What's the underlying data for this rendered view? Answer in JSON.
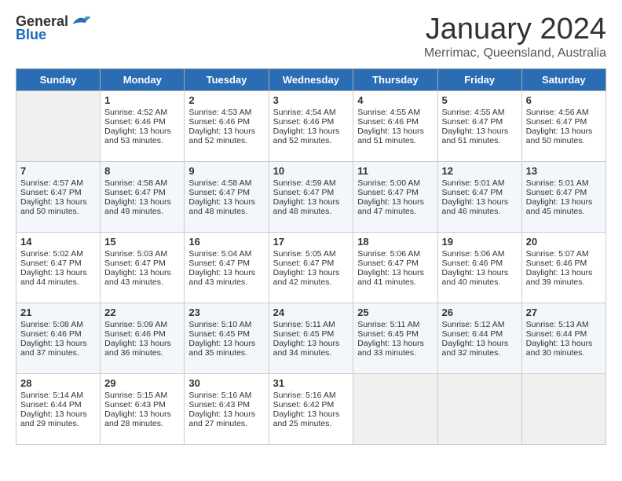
{
  "header": {
    "logo_general": "General",
    "logo_blue": "Blue",
    "title": "January 2024",
    "location": "Merrimac, Queensland, Australia"
  },
  "days_of_week": [
    "Sunday",
    "Monday",
    "Tuesday",
    "Wednesday",
    "Thursday",
    "Friday",
    "Saturday"
  ],
  "weeks": [
    [
      {
        "day": "",
        "sunrise": "",
        "sunset": "",
        "daylight": ""
      },
      {
        "day": "1",
        "sunrise": "Sunrise: 4:52 AM",
        "sunset": "Sunset: 6:46 PM",
        "daylight": "Daylight: 13 hours and 53 minutes."
      },
      {
        "day": "2",
        "sunrise": "Sunrise: 4:53 AM",
        "sunset": "Sunset: 6:46 PM",
        "daylight": "Daylight: 13 hours and 52 minutes."
      },
      {
        "day": "3",
        "sunrise": "Sunrise: 4:54 AM",
        "sunset": "Sunset: 6:46 PM",
        "daylight": "Daylight: 13 hours and 52 minutes."
      },
      {
        "day": "4",
        "sunrise": "Sunrise: 4:55 AM",
        "sunset": "Sunset: 6:46 PM",
        "daylight": "Daylight: 13 hours and 51 minutes."
      },
      {
        "day": "5",
        "sunrise": "Sunrise: 4:55 AM",
        "sunset": "Sunset: 6:47 PM",
        "daylight": "Daylight: 13 hours and 51 minutes."
      },
      {
        "day": "6",
        "sunrise": "Sunrise: 4:56 AM",
        "sunset": "Sunset: 6:47 PM",
        "daylight": "Daylight: 13 hours and 50 minutes."
      }
    ],
    [
      {
        "day": "7",
        "sunrise": "Sunrise: 4:57 AM",
        "sunset": "Sunset: 6:47 PM",
        "daylight": "Daylight: 13 hours and 50 minutes."
      },
      {
        "day": "8",
        "sunrise": "Sunrise: 4:58 AM",
        "sunset": "Sunset: 6:47 PM",
        "daylight": "Daylight: 13 hours and 49 minutes."
      },
      {
        "day": "9",
        "sunrise": "Sunrise: 4:58 AM",
        "sunset": "Sunset: 6:47 PM",
        "daylight": "Daylight: 13 hours and 48 minutes."
      },
      {
        "day": "10",
        "sunrise": "Sunrise: 4:59 AM",
        "sunset": "Sunset: 6:47 PM",
        "daylight": "Daylight: 13 hours and 48 minutes."
      },
      {
        "day": "11",
        "sunrise": "Sunrise: 5:00 AM",
        "sunset": "Sunset: 6:47 PM",
        "daylight": "Daylight: 13 hours and 47 minutes."
      },
      {
        "day": "12",
        "sunrise": "Sunrise: 5:01 AM",
        "sunset": "Sunset: 6:47 PM",
        "daylight": "Daylight: 13 hours and 46 minutes."
      },
      {
        "day": "13",
        "sunrise": "Sunrise: 5:01 AM",
        "sunset": "Sunset: 6:47 PM",
        "daylight": "Daylight: 13 hours and 45 minutes."
      }
    ],
    [
      {
        "day": "14",
        "sunrise": "Sunrise: 5:02 AM",
        "sunset": "Sunset: 6:47 PM",
        "daylight": "Daylight: 13 hours and 44 minutes."
      },
      {
        "day": "15",
        "sunrise": "Sunrise: 5:03 AM",
        "sunset": "Sunset: 6:47 PM",
        "daylight": "Daylight: 13 hours and 43 minutes."
      },
      {
        "day": "16",
        "sunrise": "Sunrise: 5:04 AM",
        "sunset": "Sunset: 6:47 PM",
        "daylight": "Daylight: 13 hours and 43 minutes."
      },
      {
        "day": "17",
        "sunrise": "Sunrise: 5:05 AM",
        "sunset": "Sunset: 6:47 PM",
        "daylight": "Daylight: 13 hours and 42 minutes."
      },
      {
        "day": "18",
        "sunrise": "Sunrise: 5:06 AM",
        "sunset": "Sunset: 6:47 PM",
        "daylight": "Daylight: 13 hours and 41 minutes."
      },
      {
        "day": "19",
        "sunrise": "Sunrise: 5:06 AM",
        "sunset": "Sunset: 6:46 PM",
        "daylight": "Daylight: 13 hours and 40 minutes."
      },
      {
        "day": "20",
        "sunrise": "Sunrise: 5:07 AM",
        "sunset": "Sunset: 6:46 PM",
        "daylight": "Daylight: 13 hours and 39 minutes."
      }
    ],
    [
      {
        "day": "21",
        "sunrise": "Sunrise: 5:08 AM",
        "sunset": "Sunset: 6:46 PM",
        "daylight": "Daylight: 13 hours and 37 minutes."
      },
      {
        "day": "22",
        "sunrise": "Sunrise: 5:09 AM",
        "sunset": "Sunset: 6:46 PM",
        "daylight": "Daylight: 13 hours and 36 minutes."
      },
      {
        "day": "23",
        "sunrise": "Sunrise: 5:10 AM",
        "sunset": "Sunset: 6:45 PM",
        "daylight": "Daylight: 13 hours and 35 minutes."
      },
      {
        "day": "24",
        "sunrise": "Sunrise: 5:11 AM",
        "sunset": "Sunset: 6:45 PM",
        "daylight": "Daylight: 13 hours and 34 minutes."
      },
      {
        "day": "25",
        "sunrise": "Sunrise: 5:11 AM",
        "sunset": "Sunset: 6:45 PM",
        "daylight": "Daylight: 13 hours and 33 minutes."
      },
      {
        "day": "26",
        "sunrise": "Sunrise: 5:12 AM",
        "sunset": "Sunset: 6:44 PM",
        "daylight": "Daylight: 13 hours and 32 minutes."
      },
      {
        "day": "27",
        "sunrise": "Sunrise: 5:13 AM",
        "sunset": "Sunset: 6:44 PM",
        "daylight": "Daylight: 13 hours and 30 minutes."
      }
    ],
    [
      {
        "day": "28",
        "sunrise": "Sunrise: 5:14 AM",
        "sunset": "Sunset: 6:44 PM",
        "daylight": "Daylight: 13 hours and 29 minutes."
      },
      {
        "day": "29",
        "sunrise": "Sunrise: 5:15 AM",
        "sunset": "Sunset: 6:43 PM",
        "daylight": "Daylight: 13 hours and 28 minutes."
      },
      {
        "day": "30",
        "sunrise": "Sunrise: 5:16 AM",
        "sunset": "Sunset: 6:43 PM",
        "daylight": "Daylight: 13 hours and 27 minutes."
      },
      {
        "day": "31",
        "sunrise": "Sunrise: 5:16 AM",
        "sunset": "Sunset: 6:42 PM",
        "daylight": "Daylight: 13 hours and 25 minutes."
      },
      {
        "day": "",
        "sunrise": "",
        "sunset": "",
        "daylight": ""
      },
      {
        "day": "",
        "sunrise": "",
        "sunset": "",
        "daylight": ""
      },
      {
        "day": "",
        "sunrise": "",
        "sunset": "",
        "daylight": ""
      }
    ]
  ]
}
